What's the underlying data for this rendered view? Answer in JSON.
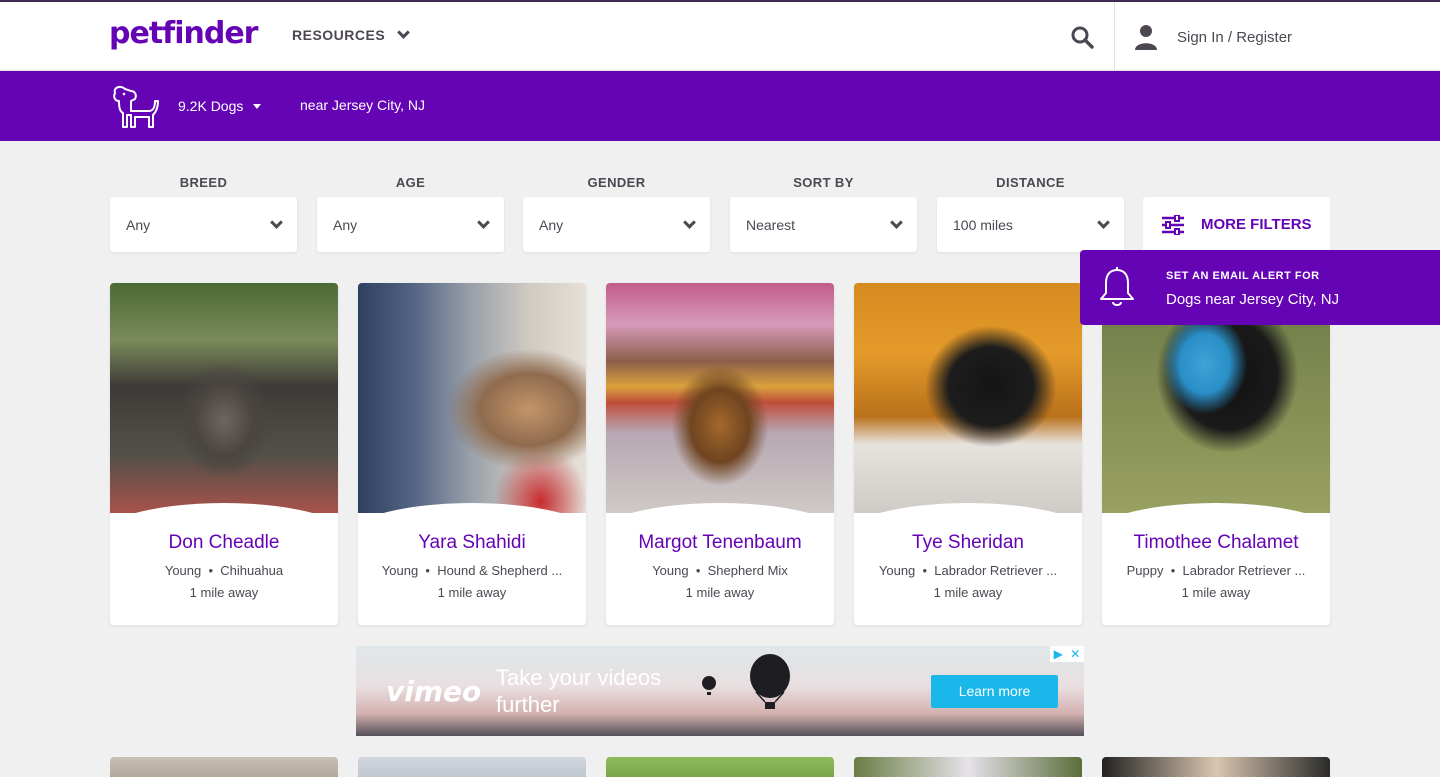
{
  "nav": {
    "logo": "petfinder",
    "resources_label": "RESOURCES",
    "sign_in_label": "Sign In / Register"
  },
  "searchbar": {
    "count_label": "9.2K Dogs",
    "location_label": "near Jersey City, NJ"
  },
  "filters": [
    {
      "label": "BREED",
      "value": "Any"
    },
    {
      "label": "AGE",
      "value": "Any"
    },
    {
      "label": "GENDER",
      "value": "Any"
    },
    {
      "label": "SORT BY",
      "value": "Nearest"
    },
    {
      "label": "DISTANCE",
      "value": "100 miles"
    }
  ],
  "more_filters_label": "MORE FILTERS",
  "email_alert": {
    "small": "SET AN EMAIL ALERT FOR",
    "big": "Dogs near Jersey City, NJ"
  },
  "pets": [
    {
      "name": "Don Cheadle",
      "age": "Young",
      "breed": "Chihuahua",
      "distance": "1 mile away"
    },
    {
      "name": "Yara Shahidi",
      "age": "Young",
      "breed": "Hound & Shepherd ...",
      "distance": "1 mile away"
    },
    {
      "name": "Margot Tenenbaum",
      "age": "Young",
      "breed": "Shepherd Mix",
      "distance": "1 mile away"
    },
    {
      "name": "Tye Sheridan",
      "age": "Young",
      "breed": "Labrador Retriever ...",
      "distance": "1 mile away"
    },
    {
      "name": "Timothee Chalamet",
      "age": "Puppy",
      "breed": "Labrador Retriever ...",
      "distance": "1 mile away"
    }
  ],
  "ad": {
    "brand": "vimeo",
    "headline": "Take your videos further",
    "cta": "Learn more"
  },
  "colors": {
    "brand_purple": "#6504b5",
    "text": "#4d4751",
    "background": "#f0f0f1"
  }
}
